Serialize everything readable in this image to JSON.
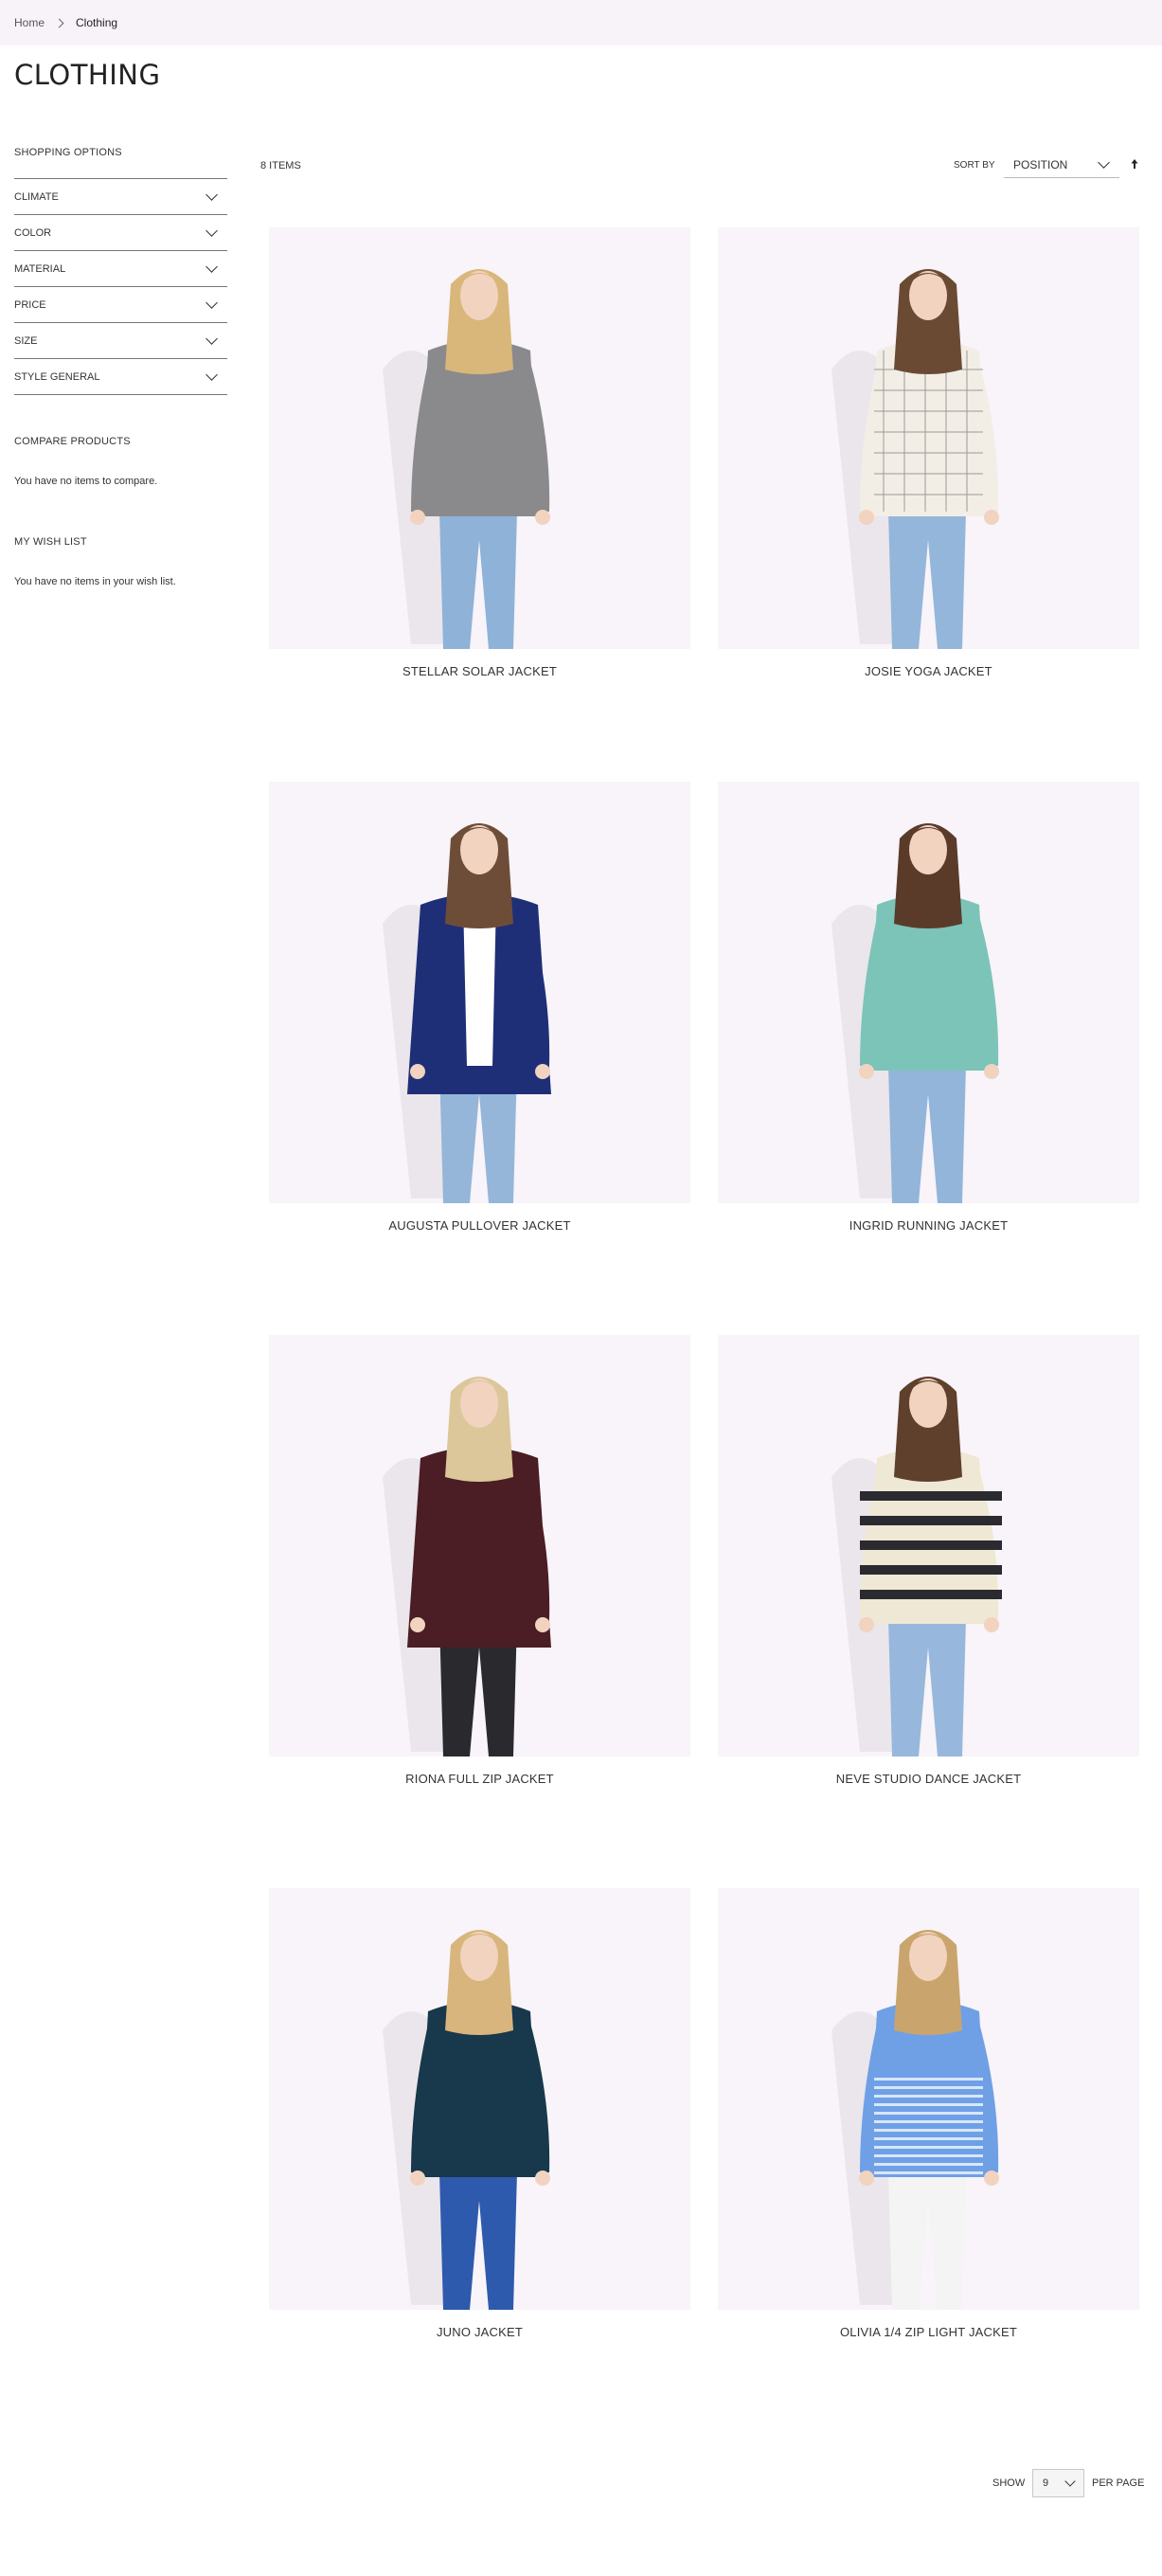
{
  "breadcrumb": {
    "home": "Home",
    "current": "Clothing"
  },
  "page_title": "CLOTHING",
  "sidebar": {
    "shopping_options": "SHOPPING OPTIONS",
    "filters": [
      "CLIMATE",
      "COLOR",
      "MATERIAL",
      "PRICE",
      "SIZE",
      "STYLE GENERAL"
    ],
    "compare_heading": "COMPARE PRODUCTS",
    "compare_text": "You have no items to compare.",
    "wishlist_heading": "MY WISH LIST",
    "wishlist_text": "You have no items in your wish list."
  },
  "toolbar": {
    "items_count": "8 ITEMS",
    "sort_by_label": "SORT BY",
    "sort_value": "POSITION",
    "sort_direction_icon": "arrow-up-icon"
  },
  "products": [
    {
      "name": "STELLAR SOLAR JACKET",
      "hair": "#d9b77a",
      "top": "#8a8a8c",
      "bottom": "#8fb2d8",
      "style": "sweater"
    },
    {
      "name": "JOSIE YOGA JACKET",
      "hair": "#6b4a34",
      "top": "#f2eee6",
      "bottom": "#94b6da",
      "style": "plaid"
    },
    {
      "name": "AUGUSTA PULLOVER JACKET",
      "hair": "#6e4d38",
      "top": "#1f2f77",
      "bottom": "#95b6d9",
      "style": "blazer"
    },
    {
      "name": "INGRID RUNNING JACKET",
      "hair": "#5a3b2a",
      "top": "#7cc4b8",
      "bottom": "#93b5da",
      "style": "shirt"
    },
    {
      "name": "RIONA FULL ZIP JACKET",
      "hair": "#dcc79a",
      "top": "#4b1d24",
      "bottom": "#2a2a2e",
      "style": "turtleneck"
    },
    {
      "name": "NEVE STUDIO DANCE JACKET",
      "hair": "#5e402c",
      "top": "#efe8d4",
      "bottom": "#97b8dc",
      "style": "striped"
    },
    {
      "name": "JUNO JACKET",
      "hair": "#d8b57c",
      "top": "#18384c",
      "bottom": "#2e5aae",
      "style": "shirt"
    },
    {
      "name": "OLIVIA 1/4 ZIP LIGHT JACKET",
      "hair": "#c9a46c",
      "top": "#6fa0e6",
      "bottom": "#f4f4f4",
      "style": "tee"
    }
  ],
  "pager": {
    "show_label": "SHOW",
    "limit_value": "9",
    "per_page_label": "PER PAGE"
  }
}
